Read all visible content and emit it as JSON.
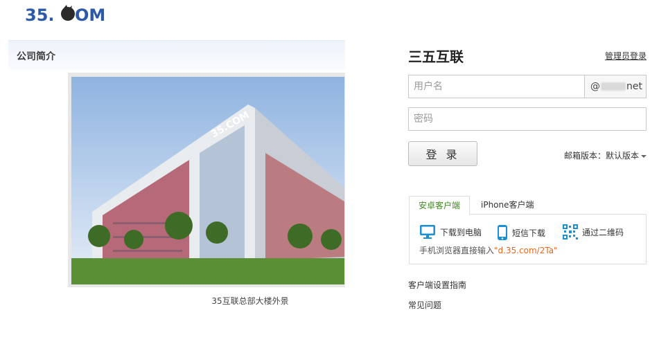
{
  "logo": {
    "text": "35.COM"
  },
  "about": {
    "heading": "公司简介",
    "photo_caption": "35互联总部大楼外景"
  },
  "login": {
    "brand_title": "三五互联",
    "admin_link": "管理员登录",
    "username_placeholder": "用户名",
    "domain_prefix": "@",
    "domain_suffix": "net",
    "password_placeholder": "密码",
    "login_button": "登 录",
    "version_label": "邮箱版本：默认版本"
  },
  "client": {
    "tabs": [
      {
        "label": "安卓客户端",
        "active": true
      },
      {
        "label": "iPhone客户端",
        "active": false
      }
    ],
    "downloads": [
      {
        "label": "下载到电脑",
        "icon": "monitor-icon"
      },
      {
        "label": "短信下载",
        "icon": "phone-icon"
      },
      {
        "label": "通过二维码",
        "icon": "qrcode-icon"
      }
    ],
    "hint_text": "手机浏览器直接输入",
    "hint_url": "\"d.35.com/2Ta\""
  },
  "links": {
    "setup_guide": "客户端设置指南",
    "faq": "常见问题"
  },
  "colors": {
    "accent_blue": "#1a8fd6",
    "tab_green": "#3f8a1b",
    "url_orange": "#e8651c"
  }
}
